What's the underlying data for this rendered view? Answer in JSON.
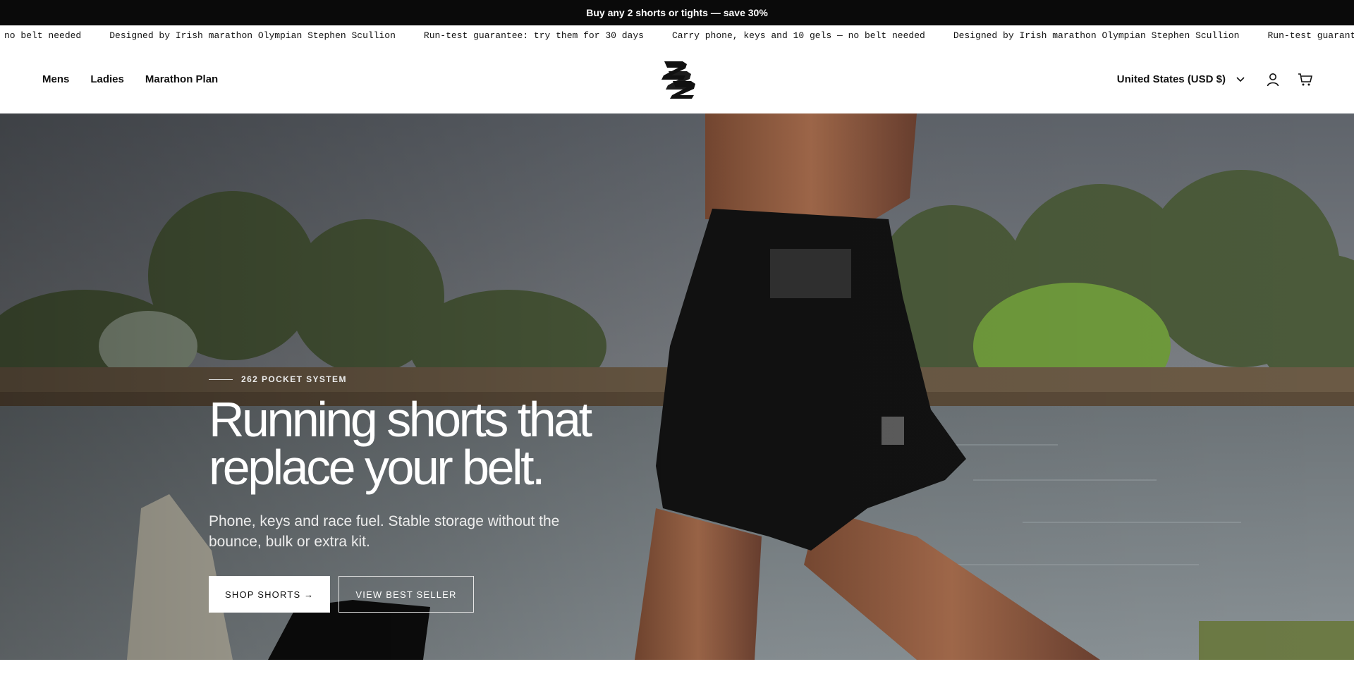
{
  "announcement": {
    "text": "Buy any 2 shorts or tights — save 30%"
  },
  "ticker": {
    "items": [
      "no belt needed",
      "Designed by Irish marathon Olympian Stephen Scullion",
      "Run-test guarantee: try them for 30 days",
      "Carry phone, keys and 10 gels — no belt needed",
      "Designed by Irish marathon Olympian Stephen Scullion",
      "Run-test guarantee: try th"
    ]
  },
  "header": {
    "nav": [
      "Mens",
      "Ladies",
      "Marathon Plan"
    ],
    "logo_icon": "brand-262-logo",
    "currency": "United States (USD $)",
    "icons": {
      "currency_dropdown": "chevron-down-icon",
      "account": "user-icon",
      "cart": "cart-icon"
    }
  },
  "hero": {
    "eyebrow": "262 POCKET SYSTEM",
    "headline": "Running shorts that replace your belt.",
    "subheadline": "Phone, keys and race fuel. Stable storage without the bounce, bulk or extra kit.",
    "primary_cta": "SHOP SHORTS →",
    "secondary_cta": "VIEW BEST SELLER"
  },
  "colors": {
    "announcement_bg": "#0a0a0a",
    "header_bg": "#ffffff",
    "cta_primary_bg": "#ffffff",
    "hero_text": "#ffffff"
  }
}
